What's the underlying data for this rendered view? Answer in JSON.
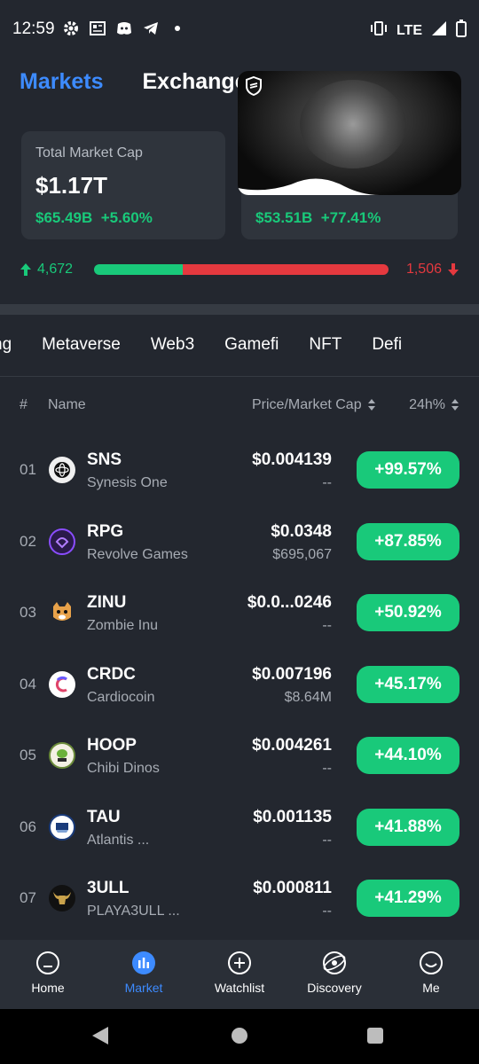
{
  "status_bar": {
    "time": "12:59",
    "network": "LTE",
    "icons": [
      "gear-icon",
      "news-icon",
      "discord-icon",
      "telegram-icon",
      "dot-icon"
    ]
  },
  "header": {
    "tabs": [
      {
        "label": "Markets",
        "active": true
      },
      {
        "label": "Exchanges",
        "active": false
      }
    ]
  },
  "cards": [
    {
      "title": "Total Market Cap",
      "value": "$1.17T",
      "change_amount": "$65.49B",
      "change_pct": "+5.60%"
    },
    {
      "title": "",
      "value": "",
      "change_amount": "$53.51B",
      "change_pct": "+77.41%"
    }
  ],
  "breadth": {
    "advancers": "4,672",
    "decliners": "1,506",
    "advancer_fraction": 0.3
  },
  "categories": [
    "ng",
    "Metaverse",
    "Web3",
    "Gamefi",
    "NFT",
    "Defi"
  ],
  "table_header": {
    "rank": "#",
    "name": "Name",
    "price": "Price/Market Cap",
    "change": "24h%"
  },
  "rows": [
    {
      "rank": "01",
      "symbol": "SNS",
      "name": "Synesis One",
      "price": "$0.004139",
      "mcap": "--",
      "change": "+99.57%",
      "icon": "sns-coin-icon"
    },
    {
      "rank": "02",
      "symbol": "RPG",
      "name": "Revolve Games",
      "price": "$0.0348",
      "mcap": "$695,067",
      "change": "+87.85%",
      "icon": "rpg-coin-icon"
    },
    {
      "rank": "03",
      "symbol": "ZINU",
      "name": "Zombie Inu",
      "price": "$0.0...0246",
      "mcap": "--",
      "change": "+50.92%",
      "icon": "zinu-coin-icon"
    },
    {
      "rank": "04",
      "symbol": "CRDC",
      "name": "Cardiocoin",
      "price": "$0.007196",
      "mcap": "$8.64M",
      "change": "+45.17%",
      "icon": "crdc-coin-icon"
    },
    {
      "rank": "05",
      "symbol": "HOOP",
      "name": "Chibi Dinos",
      "price": "$0.004261",
      "mcap": "--",
      "change": "+44.10%",
      "icon": "hoop-coin-icon"
    },
    {
      "rank": "06",
      "symbol": "TAU",
      "name": "Atlantis ...",
      "price": "$0.001135",
      "mcap": "--",
      "change": "+41.88%",
      "icon": "tau-coin-icon"
    },
    {
      "rank": "07",
      "symbol": "3ULL",
      "name": "PLAYA3ULL ...",
      "price": "$0.000811",
      "mcap": "--",
      "change": "+41.29%",
      "icon": "3ull-coin-icon"
    }
  ],
  "bottom_nav": [
    {
      "label": "Home",
      "icon": "home-icon",
      "active": false
    },
    {
      "label": "Market",
      "icon": "market-icon",
      "active": true
    },
    {
      "label": "Watchlist",
      "icon": "watchlist-icon",
      "active": false
    },
    {
      "label": "Discovery",
      "icon": "discovery-icon",
      "active": false
    },
    {
      "label": "Me",
      "icon": "me-icon",
      "active": false
    }
  ],
  "colors": {
    "background": "#23272f",
    "card": "#2f343c",
    "accent": "#3d8bff",
    "positive": "#19c97a",
    "negative": "#e5393f"
  }
}
